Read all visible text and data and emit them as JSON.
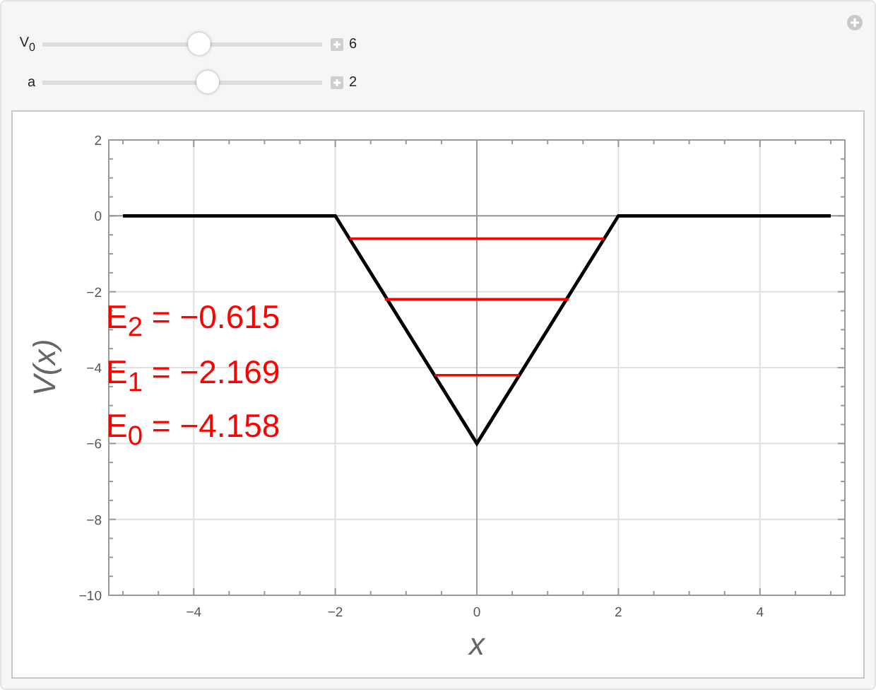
{
  "controls": [
    {
      "label": "V",
      "label_sub": "0",
      "level": 0.56,
      "value": "6"
    },
    {
      "label": "a",
      "level": 0.59,
      "value": "2"
    }
  ],
  "plot": {
    "energy_labels": [
      "E$_{2}$ = −0.615",
      "E$_{1}$ = −2.169",
      "E$_{0}$ = −4.158"
    ],
    "chart_data": {
      "type": "line",
      "grid": true,
      "xlabel": "x",
      "ylabel": "V(x)",
      "xlim": [
        -5.2,
        5.2
      ],
      "ylim": [
        -10,
        2
      ],
      "xticks": [
        -4,
        -2,
        0,
        2,
        4
      ],
      "yticks": [
        2,
        0,
        -2,
        -4,
        -6,
        -8,
        -10
      ],
      "series": [
        {
          "color": "#000000",
          "x": [
            -5,
            -2,
            0,
            2,
            5
          ],
          "values": [
            0,
            0,
            -6,
            0,
            0
          ]
        },
        {
          "color": "#ff0000",
          "x": [
            -1.8,
            1.8
          ],
          "values": [
            -0.6,
            -0.6
          ]
        },
        {
          "color": "#ff0000",
          "x": [
            -1.3,
            1.3
          ],
          "values": [
            -2.2,
            -2.2
          ]
        },
        {
          "color": "#ff0000",
          "x": [
            -0.6,
            0.6
          ],
          "values": [
            -4.2,
            -4.2
          ]
        }
      ]
    }
  }
}
